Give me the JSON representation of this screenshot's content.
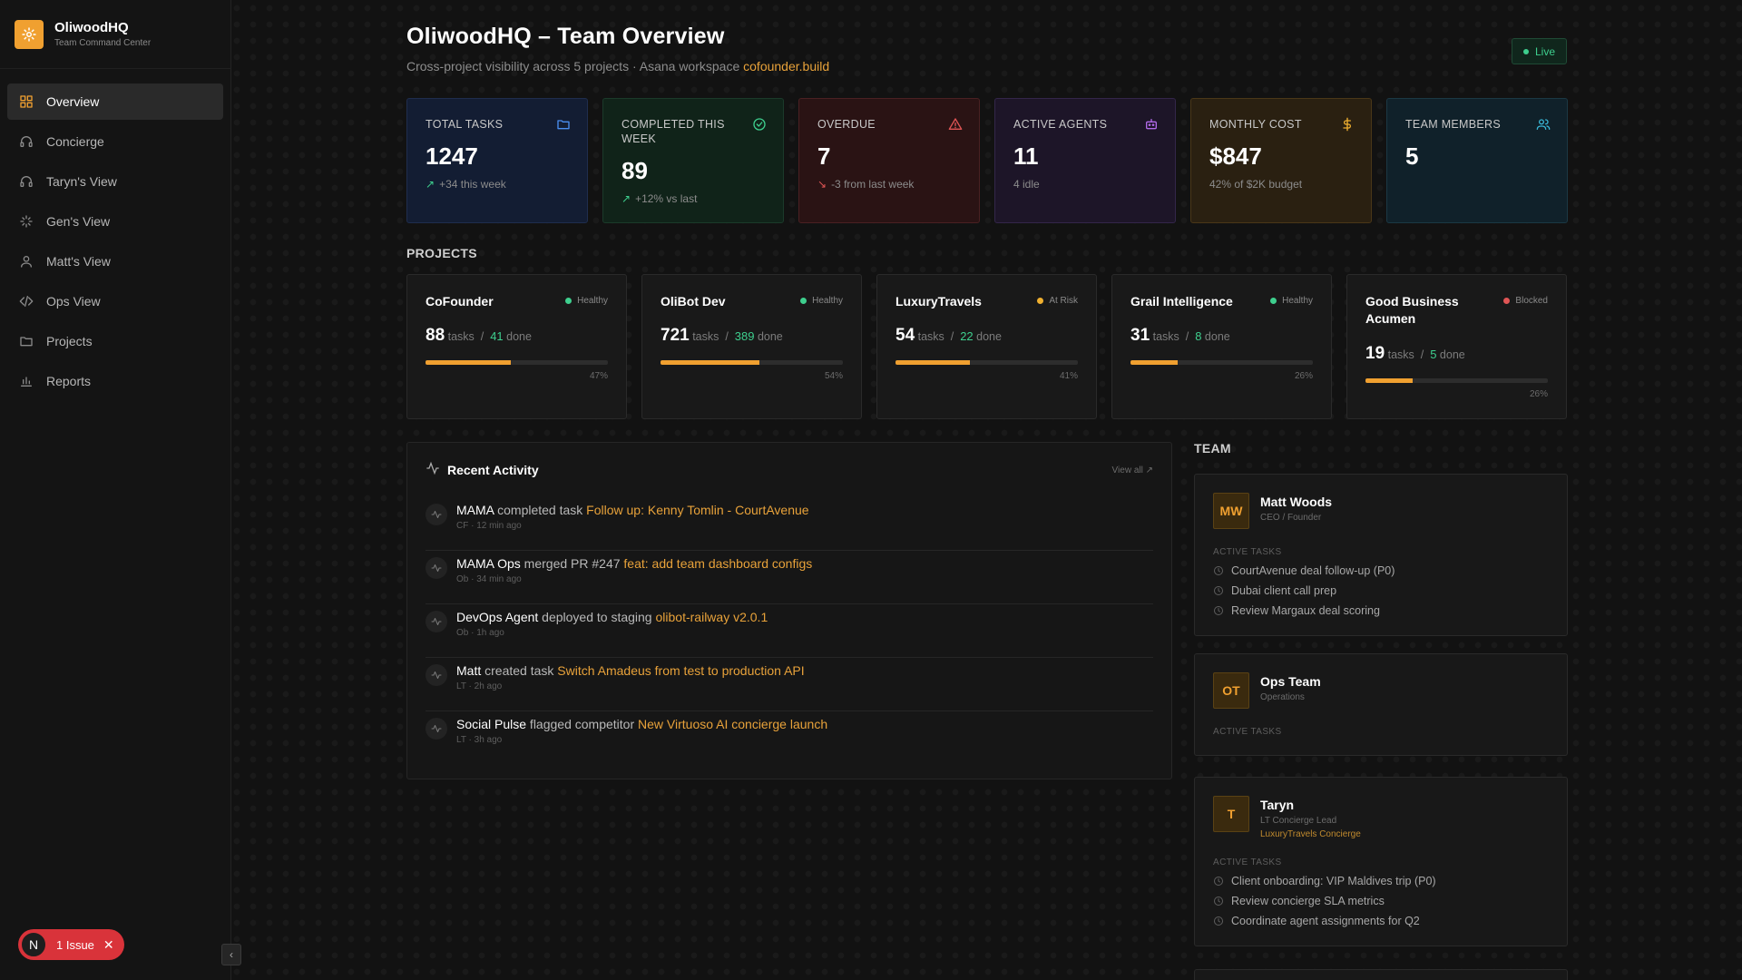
{
  "brand": {
    "title": "OliwoodHQ",
    "subtitle": "Team Command Center"
  },
  "nav": [
    {
      "label": "Overview",
      "icon": "grid-icon",
      "active": true
    },
    {
      "label": "Concierge",
      "icon": "headset-icon"
    },
    {
      "label": "Taryn's View",
      "icon": "headset-icon"
    },
    {
      "label": "Gen's View",
      "icon": "sparkle-icon"
    },
    {
      "label": "Matt's View",
      "icon": "user-icon"
    },
    {
      "label": "Ops View",
      "icon": "code-icon"
    },
    {
      "label": "Projects",
      "icon": "folder-icon"
    },
    {
      "label": "Reports",
      "icon": "bar-chart-icon"
    }
  ],
  "issue": {
    "avatar": "N",
    "label": "1 Issue"
  },
  "header": {
    "title": "OliwoodHQ – Team Overview",
    "subtitle_prefix": "Cross-project visibility across 5 projects · Asana workspace ",
    "subtitle_link": "cofounder.build",
    "live": "Live"
  },
  "stats": [
    {
      "label": "TOTAL TASKS",
      "value": "1247",
      "delta": "+34 this week",
      "trend": "up",
      "icon": "folder-icon",
      "color": "#4a8ef0"
    },
    {
      "label": "COMPLETED THIS WEEK",
      "value": "89",
      "delta": "+12% vs last",
      "trend": "up",
      "icon": "check-circle-icon",
      "color": "#3ecf8e"
    },
    {
      "label": "OVERDUE",
      "value": "7",
      "delta": "-3 from last week",
      "trend": "down",
      "icon": "warning-icon",
      "color": "#e05555"
    },
    {
      "label": "ACTIVE AGENTS",
      "value": "11",
      "delta": "4 idle",
      "trend": "none",
      "icon": "robot-icon",
      "color": "#b06ae8"
    },
    {
      "label": "MONTHLY COST",
      "value": "$847",
      "delta": "42% of $2K budget",
      "trend": "none",
      "icon": "dollar-icon",
      "color": "#f0b030"
    },
    {
      "label": "TEAM MEMBERS",
      "value": "5",
      "delta": "",
      "trend": "none",
      "icon": "users-icon",
      "color": "#3ab8d8"
    }
  ],
  "projects_label": "PROJECTS",
  "projects": [
    {
      "name": "CoFounder",
      "status": "Healthy",
      "status_color": "#3ecf8e",
      "tasks": "88",
      "done": "41",
      "pct_label": "47%",
      "pct": 0.47
    },
    {
      "name": "OliBot Dev",
      "status": "Healthy",
      "status_color": "#3ecf8e",
      "tasks": "721",
      "done": "389",
      "pct_label": "54%",
      "pct": 0.54
    },
    {
      "name": "LuxuryTravels",
      "status": "At Risk",
      "status_color": "#f0b030",
      "tasks": "54",
      "done": "22",
      "pct_label": "41%",
      "pct": 0.41
    },
    {
      "name": "Grail Intelligence",
      "status": "Healthy",
      "status_color": "#3ecf8e",
      "tasks": "31",
      "done": "8",
      "pct_label": "26%",
      "pct": 0.26
    },
    {
      "name": "Good Business Acumen",
      "status": "Blocked",
      "status_color": "#e05555",
      "tasks": "19",
      "done": "5",
      "pct_label": "26%",
      "pct": 0.26
    }
  ],
  "count_words": {
    "tasks": "tasks",
    "sep": "/",
    "done": "done"
  },
  "activity": {
    "title": "Recent Activity",
    "view_all": "View all",
    "items": [
      {
        "who": "MAMA",
        "action": " completed task ",
        "object": "Follow up: Kenny Tomlin - CourtAvenue",
        "meta": "CF · 12 min ago"
      },
      {
        "who": "MAMA Ops",
        "action": " merged PR #247 ",
        "object": "feat: add team dashboard configs",
        "meta": "Ob · 34 min ago"
      },
      {
        "who": "DevOps Agent",
        "action": " deployed to staging ",
        "object": "olibot-railway v2.0.1",
        "meta": "Ob · 1h ago"
      },
      {
        "who": "Matt",
        "action": " created task ",
        "object": "Switch Amadeus from test to production API",
        "meta": "LT · 2h ago"
      },
      {
        "who": "Social Pulse",
        "action": " flagged competitor ",
        "object": "New Virtuoso AI concierge launch",
        "meta": "LT · 3h ago"
      }
    ]
  },
  "team_label": "TEAM",
  "active_tasks_label": "ACTIVE TASKS",
  "team": [
    {
      "initials": "MW",
      "name": "Matt Woods",
      "role": "CEO / Founder",
      "extra": "",
      "tasks": [
        "CourtAvenue deal follow-up (P0)",
        "Dubai client call prep",
        "Review Margaux deal scoring"
      ]
    },
    {
      "initials": "OT",
      "name": "Ops Team",
      "role": "Operations",
      "extra": "",
      "tasks": []
    },
    {
      "initials": "T",
      "name": "Taryn",
      "role": "LT Concierge Lead",
      "extra": "LuxuryTravels Concierge",
      "tasks": [
        "Client onboarding: VIP Maldives trip (P0)",
        "Review concierge SLA metrics",
        "Coordinate agent assignments for Q2"
      ]
    }
  ]
}
